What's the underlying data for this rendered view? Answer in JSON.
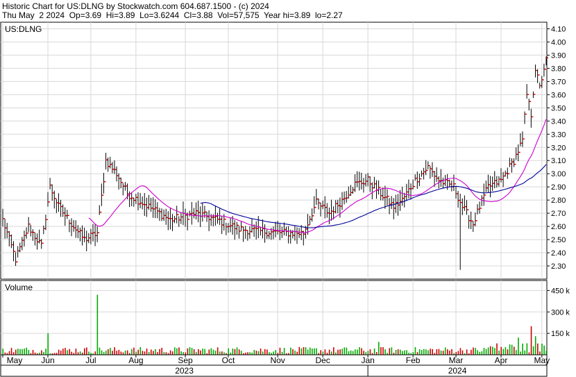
{
  "header": {
    "line1": "Historic Chart for US:DLNG by Stockwatch.com 604.687.1500 - (c) 2024",
    "line2": "Thu May  2 2024  Op=3.69  Hi=3.89  Lo=3.6244  Cl=3.88  Vol=57,575  Year hi=3.89  lo=2.27"
  },
  "colors": {
    "up_bar": "#000000",
    "close_tick": "#cc0000",
    "ma_short": "#cc00cc",
    "ma_long": "#000099",
    "vol_up": "#00aa00",
    "vol_down": "#cc0000",
    "grid": "#d8d8d8"
  },
  "chart_data": [
    {
      "type": "ohlc",
      "symbol_label": "US:DLNG",
      "ylim": [
        2.2,
        4.15
      ],
      "y_ticks": [
        "4.10",
        "4.00",
        "3.90",
        "3.80",
        "3.70",
        "3.60",
        "3.50",
        "3.40",
        "3.30",
        "3.20",
        "3.10",
        "3.00",
        "2.90",
        "2.80",
        "2.70",
        "2.60",
        "2.50",
        "2.40",
        "2.30"
      ],
      "x_month_labels": [
        "May",
        "Jun",
        "Jul",
        "Aug",
        "Sep",
        "Oct",
        "Nov",
        "Dec",
        "Jan",
        "Feb",
        "Mar",
        "Apr",
        "May"
      ],
      "x_month_index": [
        0,
        21,
        41,
        62,
        85,
        105,
        128,
        149,
        170,
        191,
        211,
        232,
        251
      ],
      "year_labels": [
        "2023",
        "2024"
      ],
      "grid": true,
      "key_points": [
        {
          "i": 0,
          "c": 2.65
        },
        {
          "i": 6,
          "c": 2.35
        },
        {
          "i": 12,
          "c": 2.6
        },
        {
          "i": 18,
          "c": 2.45
        },
        {
          "i": 22,
          "c": 2.9
        },
        {
          "i": 26,
          "c": 2.75
        },
        {
          "i": 33,
          "c": 2.6
        },
        {
          "i": 38,
          "c": 2.5
        },
        {
          "i": 44,
          "c": 2.55
        },
        {
          "i": 48,
          "c": 3.1
        },
        {
          "i": 53,
          "c": 3.0
        },
        {
          "i": 58,
          "c": 2.85
        },
        {
          "i": 68,
          "c": 2.75
        },
        {
          "i": 78,
          "c": 2.65
        },
        {
          "i": 90,
          "c": 2.7
        },
        {
          "i": 100,
          "c": 2.65
        },
        {
          "i": 110,
          "c": 2.58
        },
        {
          "i": 122,
          "c": 2.56
        },
        {
          "i": 133,
          "c": 2.55
        },
        {
          "i": 140,
          "c": 2.55
        },
        {
          "i": 146,
          "c": 2.78
        },
        {
          "i": 152,
          "c": 2.7
        },
        {
          "i": 158,
          "c": 2.8
        },
        {
          "i": 164,
          "c": 2.92
        },
        {
          "i": 170,
          "c": 2.95
        },
        {
          "i": 176,
          "c": 2.85
        },
        {
          "i": 182,
          "c": 2.75
        },
        {
          "i": 186,
          "c": 2.8
        },
        {
          "i": 192,
          "c": 2.95
        },
        {
          "i": 198,
          "c": 3.05
        },
        {
          "i": 203,
          "c": 2.95
        },
        {
          "i": 210,
          "c": 2.9
        },
        {
          "i": 214,
          "c": 2.75
        },
        {
          "i": 219,
          "c": 2.62
        },
        {
          "i": 222,
          "c": 2.75
        },
        {
          "i": 226,
          "c": 2.9
        },
        {
          "i": 232,
          "c": 2.95
        },
        {
          "i": 238,
          "c": 3.1
        },
        {
          "i": 242,
          "c": 3.25
        },
        {
          "i": 244,
          "c": 3.6
        },
        {
          "i": 246,
          "c": 3.45
        },
        {
          "i": 248,
          "c": 3.8
        },
        {
          "i": 250,
          "c": 3.65
        },
        {
          "i": 253,
          "c": 3.88
        }
      ],
      "extremes": [
        {
          "i": 6,
          "low": 2.3
        },
        {
          "i": 213,
          "low": 2.27
        },
        {
          "i": 253,
          "high": 3.89
        }
      ]
    },
    {
      "type": "bar",
      "title": "Volume",
      "y_ticks": [
        "450 k",
        "300 k",
        "150 k"
      ],
      "ylim": [
        0,
        520
      ],
      "unit": "thousand shares",
      "peaks": [
        {
          "i": 21,
          "v": 150
        },
        {
          "i": 44,
          "v": 420
        },
        {
          "i": 175,
          "v": 90
        },
        {
          "i": 240,
          "v": 120
        },
        {
          "i": 246,
          "v": 200
        },
        {
          "i": 248,
          "v": 130
        }
      ]
    }
  ]
}
